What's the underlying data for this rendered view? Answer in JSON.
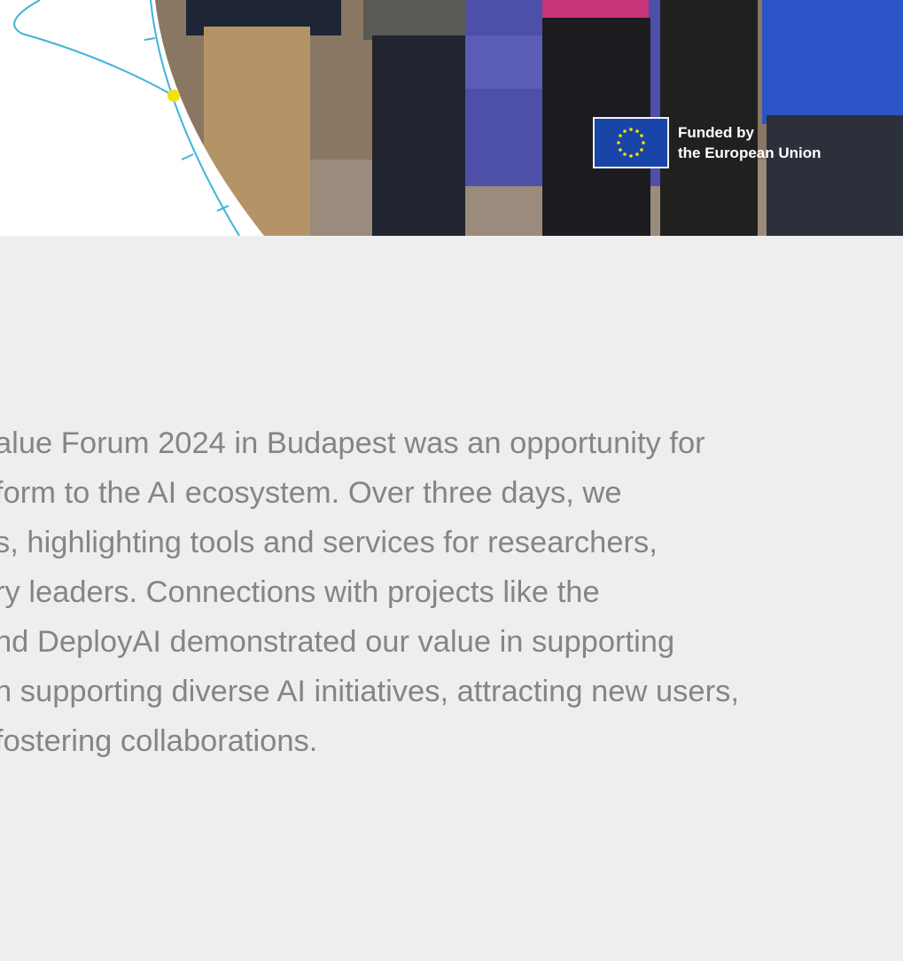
{
  "hero": {
    "image_alt": "Group photo of team members at the AI on Demand booth",
    "eu_badge": {
      "line1": "Funded by",
      "line2": "the European Union",
      "flag_color": "#1a45a8",
      "star_color": "#f5e400"
    },
    "accent_line_color": "#3fb3d9",
    "accent_dot_color": "#f2e10f"
  },
  "article": {
    "lines": [
      "alue Forum 2024 in Budapest was an opportunity for",
      "form to the AI ecosystem. Over three days, we",
      "s, highlighting tools and services for researchers,",
      "ry leaders. Connections with projects like the",
      "nd DeployAI demonstrated our value in supporting",
      "n supporting diverse AI initiatives, attracting new users,",
      "fostering collaborations."
    ]
  },
  "colors": {
    "background": "#eeeeee",
    "text": "#858585"
  }
}
